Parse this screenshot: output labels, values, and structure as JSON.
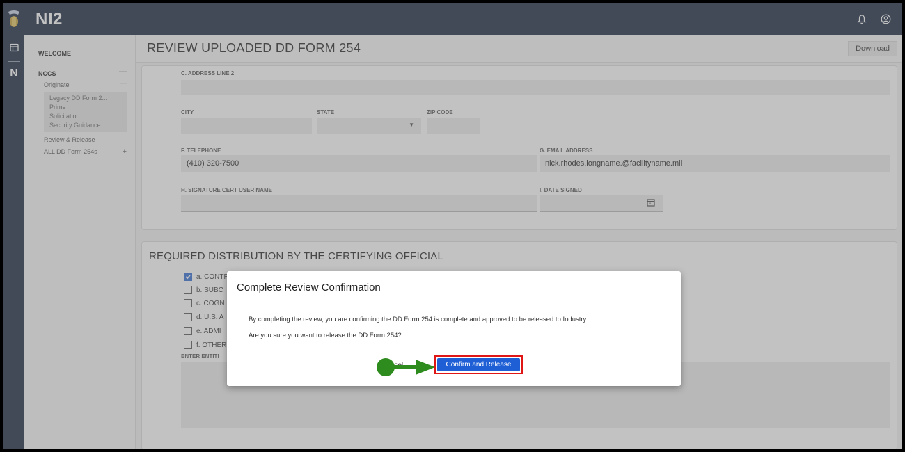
{
  "app": {
    "title": "NI2"
  },
  "sidebar": {
    "welcome": "WELCOME",
    "section": "NCCS",
    "originate": "Originate",
    "group_items": [
      "Legacy DD Form 2...",
      "Prime",
      "Solicitation",
      "Security Guidance"
    ],
    "review_release": "Review & Release",
    "all_forms": "ALL DD Form 254s"
  },
  "page": {
    "title": "REVIEW UPLOADED DD FORM 254",
    "download_label": "Download"
  },
  "form": {
    "address_line2_label": "C. ADDRESS LINE 2",
    "address_line2_value": "",
    "city_label": "CITY",
    "state_label": "STATE",
    "zip_label": "ZIP CODE",
    "telephone_label": "F. TELEPHONE",
    "telephone_value": "(410) 320-7500",
    "email_label": "G. EMAIL ADDRESS",
    "email_value": "nick.rhodes.longname.@facilityname.mil",
    "signature_label": "H. SIGNATURE CERT USER NAME",
    "date_signed_label": "I. DATE SIGNED"
  },
  "distribution": {
    "title": "REQUIRED DISTRIBUTION BY THE CERTIFYING OFFICIAL",
    "items": [
      {
        "label": "a. CONTR",
        "checked": true
      },
      {
        "label": "b. SUBC",
        "checked": false
      },
      {
        "label": "c. COGN",
        "checked": false
      },
      {
        "label": "d. U.S. A",
        "checked": false
      },
      {
        "label": "e. ADMI",
        "checked": false
      },
      {
        "label": "f. OTHER",
        "checked": false
      }
    ],
    "enter_entities_label": "ENTER ENTITI"
  },
  "modal": {
    "title": "Complete Review Confirmation",
    "text1": "By completing the review, you are confirming the DD Form 254 is complete and approved to be released to Industry.",
    "text2": "Are you sure you want to release the DD Form 254?",
    "cancel_label": "Cancel",
    "confirm_label": "Confirm and Release"
  },
  "colors": {
    "topbar": "#16263f",
    "primary_button": "#1f5fd6",
    "highlight": "#e01616",
    "pointer": "#2e8b1e"
  }
}
